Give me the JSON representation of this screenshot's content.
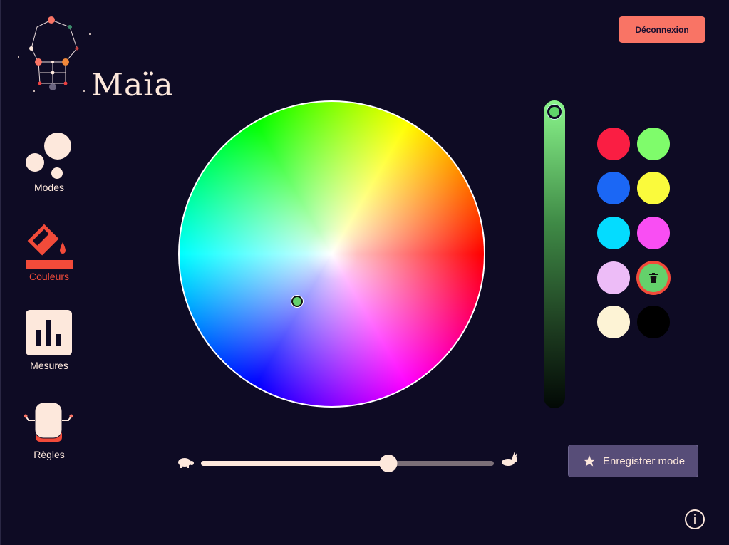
{
  "app": {
    "name": "Maïa"
  },
  "header": {
    "logout_label": "Déconnexion"
  },
  "nav": {
    "items": [
      {
        "label": "Modes",
        "icon": "bubbles-icon",
        "active": false
      },
      {
        "label": "Couleurs",
        "icon": "paint-bucket-icon",
        "active": true
      },
      {
        "label": "Mesures",
        "icon": "bar-chart-icon",
        "active": false
      },
      {
        "label": "Règles",
        "icon": "robot-icon",
        "active": false
      }
    ]
  },
  "color_picker": {
    "selected_color": "#64d16b",
    "brightness_level": 1.0
  },
  "swatches": [
    {
      "color": "#fa1e43"
    },
    {
      "color": "#7ffc6b"
    },
    {
      "color": "#1b67f5"
    },
    {
      "color": "#fafa3c"
    },
    {
      "color": "#04dcff"
    },
    {
      "color": "#f94ef3"
    },
    {
      "color": "#edbcf7"
    },
    {
      "color": "#64d16b",
      "selected": true
    },
    {
      "color": "#fdf3d5"
    },
    {
      "color": "#000000"
    }
  ],
  "speed": {
    "value": 0.64
  },
  "actions": {
    "save_mode_label": "Enregistrer mode"
  },
  "info": {
    "label": "i"
  },
  "colors": {
    "background": "#0e0b24",
    "accent": "#f97465",
    "active_nav": "#f24b3a",
    "cream": "#fde8dc",
    "save_button": "#574d78"
  }
}
